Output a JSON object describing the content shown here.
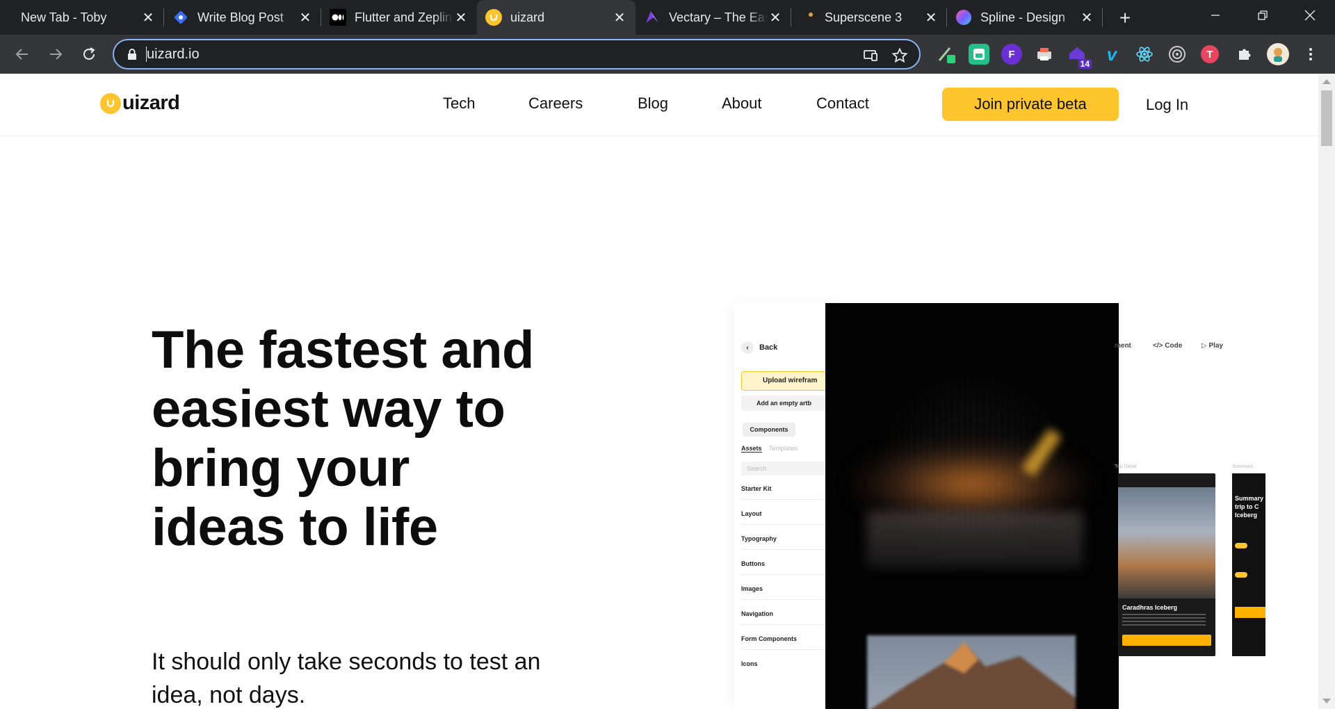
{
  "browser": {
    "tabs": [
      {
        "title": "New Tab - Toby",
        "favicon": "none"
      },
      {
        "title": "Write Blog Post",
        "favicon": "blue-diamond-icon"
      },
      {
        "title": "Flutter and Zeplin",
        "favicon": "medium-icon"
      },
      {
        "title": "uizard",
        "favicon": "uizard-icon"
      },
      {
        "title": "Vectary – The Easiest",
        "favicon": "vectary-icon"
      },
      {
        "title": "Superscene 3",
        "favicon": "superscene-icon"
      },
      {
        "title": "Spline - Design",
        "favicon": "spline-icon"
      }
    ],
    "active_tab_index": 3,
    "url": "uizard.io",
    "extension_badge": "14",
    "colors": {
      "chrome_dark": "#202124",
      "chrome_toolbar": "#35363a",
      "focus_ring": "#8ab4f8"
    }
  },
  "site": {
    "logo_text": "uizard",
    "nav": [
      "Tech",
      "Careers",
      "Blog",
      "About",
      "Contact"
    ],
    "cta": "Join private beta",
    "login": "Log In",
    "hero_title": "The fastest and easiest way to bring your ideas to life",
    "hero_subtitle": "It should only take seconds to test an idea, not days.",
    "accent_color": "#ffc52e"
  },
  "preview": {
    "back": "Back",
    "upload": "Upload wirefram",
    "add_empty": "Add an empty artb",
    "tab_components": "Components",
    "tab_assets": "Assets",
    "tab_templates": "Templates",
    "search_placeholder": "Search",
    "items": [
      "Starter Kit",
      "Layout",
      "Typography",
      "Buttons",
      "Images",
      "Navigation",
      "Form Components",
      "Icons"
    ],
    "topbar_comment": "ment",
    "topbar_code": "Code",
    "topbar_play": "Play",
    "screen_label_1": "Trip Detail",
    "screen_label_2": "Summary",
    "card_title": "Caradhras Iceberg",
    "summary_title": "Summary trip to C Iceberg"
  }
}
